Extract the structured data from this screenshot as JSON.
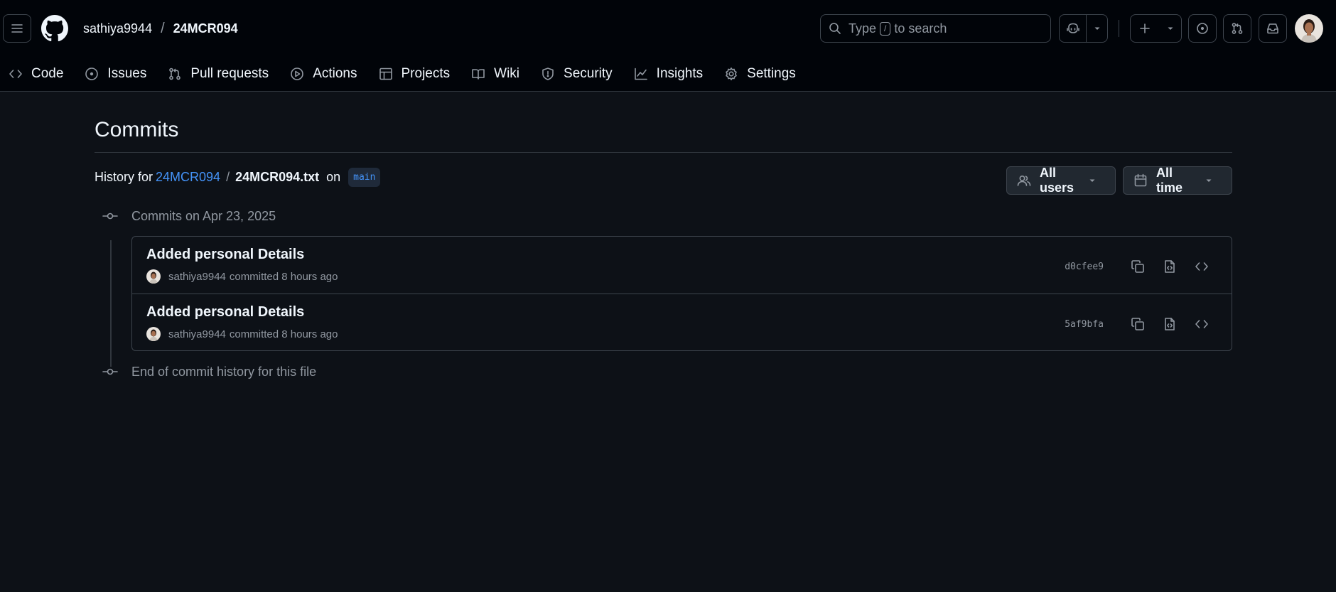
{
  "header": {
    "owner": "sathiya9944",
    "separator": "/",
    "repo": "24MCR094",
    "search": {
      "prefix": "Type",
      "key": "/",
      "suffix": "to search"
    }
  },
  "tabs": [
    {
      "label": "Code",
      "icon": "code-icon"
    },
    {
      "label": "Issues",
      "icon": "issue-icon"
    },
    {
      "label": "Pull requests",
      "icon": "pull-request-icon"
    },
    {
      "label": "Actions",
      "icon": "play-icon"
    },
    {
      "label": "Projects",
      "icon": "table-icon"
    },
    {
      "label": "Wiki",
      "icon": "book-icon"
    },
    {
      "label": "Security",
      "icon": "shield-icon"
    },
    {
      "label": "Insights",
      "icon": "graph-icon"
    },
    {
      "label": "Settings",
      "icon": "gear-icon"
    }
  ],
  "page": {
    "title": "Commits",
    "history_prefix": "History for",
    "history_repo": "24MCR094",
    "history_sep": "/",
    "history_file": "24MCR094.txt",
    "history_on": "on",
    "branch": "main",
    "filter_users": "All users",
    "filter_time": "All time",
    "group_heading": "Commits on Apr 23, 2025",
    "end_text": "End of commit history for this file"
  },
  "commits": [
    {
      "title": "Added personal Details",
      "author": "sathiya9944",
      "verb": "committed 8 hours ago",
      "sha": "d0cfee9"
    },
    {
      "title": "Added personal Details",
      "author": "sathiya9944",
      "verb": "committed 8 hours ago",
      "sha": "5af9bfa"
    }
  ],
  "colors": {
    "background": "#0d1117",
    "header": "#010409",
    "link": "#4493f8",
    "border": "#3d444d",
    "muted": "#9198a1"
  }
}
